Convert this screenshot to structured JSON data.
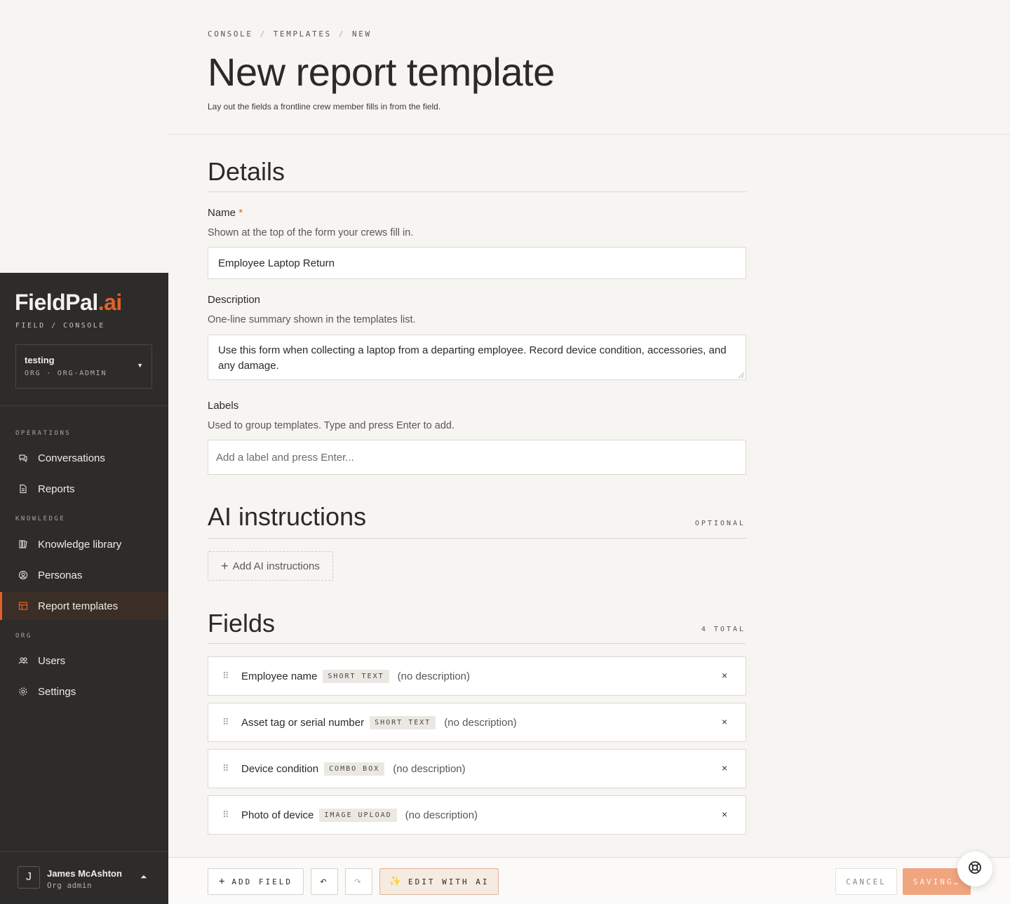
{
  "sidebar": {
    "brand_main": "FieldPal",
    "brand_accent": ".ai",
    "brand_sub": "FIELD / CONSOLE",
    "org": {
      "name": "testing",
      "role": "ORG · ORG-ADMIN"
    },
    "sections": {
      "operations": "OPERATIONS",
      "knowledge": "KNOWLEDGE",
      "org": "ORG"
    },
    "items": [
      {
        "label": "Conversations",
        "icon": "chat-icon"
      },
      {
        "label": "Reports",
        "icon": "document-icon"
      },
      {
        "label": "Knowledge library",
        "icon": "library-icon"
      },
      {
        "label": "Personas",
        "icon": "persona-icon"
      },
      {
        "label": "Report templates",
        "icon": "template-icon",
        "active": true
      },
      {
        "label": "Users",
        "icon": "users-icon"
      },
      {
        "label": "Settings",
        "icon": "gear-icon"
      }
    ],
    "user": {
      "initial": "J",
      "name": "James McAshton",
      "role": "Org admin"
    }
  },
  "header": {
    "breadcrumb": [
      "CONSOLE",
      "TEMPLATES",
      "NEW"
    ],
    "breadcrumb_sep": "/",
    "title": "New report template",
    "subtitle": "Lay out the fields a frontline crew member fills in from the field."
  },
  "details": {
    "title": "Details",
    "name": {
      "label": "Name",
      "required_mark": "*",
      "help": "Shown at the top of the form your crews fill in.",
      "value": "Employee Laptop Return"
    },
    "description": {
      "label": "Description",
      "help": "One-line summary shown in the templates list.",
      "value": "Use this form when collecting a laptop from a departing employee. Record device condition, accessories, and any damage."
    },
    "labels": {
      "label": "Labels",
      "help": "Used to group templates. Type and press Enter to add.",
      "placeholder": "Add a label and press Enter..."
    }
  },
  "ai_instructions": {
    "title": "AI instructions",
    "meta": "OPTIONAL",
    "add_label": "Add AI instructions"
  },
  "fields": {
    "title": "Fields",
    "meta": "4 TOTAL",
    "items": [
      {
        "name": "Employee name",
        "type": "SHORT TEXT",
        "description": "(no description)"
      },
      {
        "name": "Asset tag or serial number",
        "type": "SHORT TEXT",
        "description": "(no description)"
      },
      {
        "name": "Device condition",
        "type": "COMBO BOX",
        "description": "(no description)"
      },
      {
        "name": "Photo of device",
        "type": "IMAGE UPLOAD",
        "description": "(no description)"
      }
    ],
    "remove_glyph": "×"
  },
  "toolbar": {
    "add_field": "ADD FIELD",
    "undo_glyph": "↶",
    "redo_glyph": "↷",
    "edit_ai": "EDIT WITH AI",
    "cancel": "CANCEL",
    "save": "SAVING…"
  },
  "colors": {
    "accent": "#e0622a",
    "sidebar_bg": "#2d2c2a",
    "page_bg": "#f7f5f2"
  }
}
